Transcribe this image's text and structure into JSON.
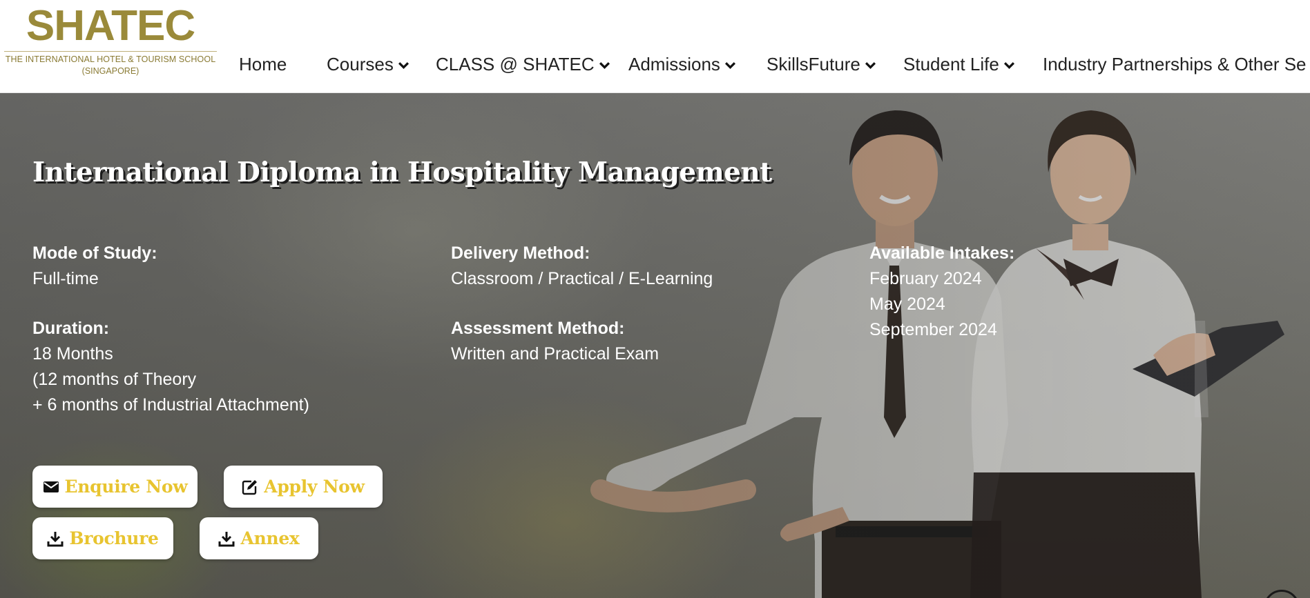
{
  "brand": {
    "name": "SHATEC",
    "tagline_line1": "THE INTERNATIONAL HOTEL & TOURISM SCHOOL",
    "tagline_line2": "(SINGAPORE)",
    "color": "#9a8a3a"
  },
  "nav": {
    "items": [
      {
        "label": "Home",
        "has_dropdown": false
      },
      {
        "label": "Courses",
        "has_dropdown": true
      },
      {
        "label": "CLASS @ SHATEC",
        "has_dropdown": true
      },
      {
        "label": "Admissions",
        "has_dropdown": true
      },
      {
        "label": "SkillsFuture",
        "has_dropdown": true
      },
      {
        "label": "Student Life",
        "has_dropdown": true
      },
      {
        "label": "Industry Partnerships & Other Se",
        "has_dropdown": false
      }
    ],
    "dropdown_icon": "chevron-down-icon"
  },
  "hero": {
    "title": "International Diploma in Hospitality Management",
    "mode_of_study": {
      "label": "Mode of Study:",
      "value": "Full-time"
    },
    "duration": {
      "label": "Duration:",
      "lines": [
        "18 Months",
        "(12 months of Theory",
        "+ 6 months of Industrial Attachment)"
      ]
    },
    "delivery_method": {
      "label": "Delivery Method:",
      "value": "Classroom / Practical / E-Learning"
    },
    "assessment_method": {
      "label": "Assessment Method:",
      "value": "Written and Practical Exam"
    },
    "available_intakes": {
      "label": "Available Intakes:",
      "values": [
        "February 2024",
        "May 2024",
        "September 2024"
      ]
    }
  },
  "buttons": {
    "enquire": {
      "label": "Enquire Now",
      "icon": "envelope-icon"
    },
    "apply": {
      "label": "Apply Now",
      "icon": "edit-icon"
    },
    "brochure": {
      "label": "Brochure",
      "icon": "download-icon"
    },
    "annex": {
      "label": "Annex",
      "icon": "download-icon"
    }
  },
  "colors": {
    "button_text": "#e8c430",
    "hero_text": "#ffffff"
  }
}
